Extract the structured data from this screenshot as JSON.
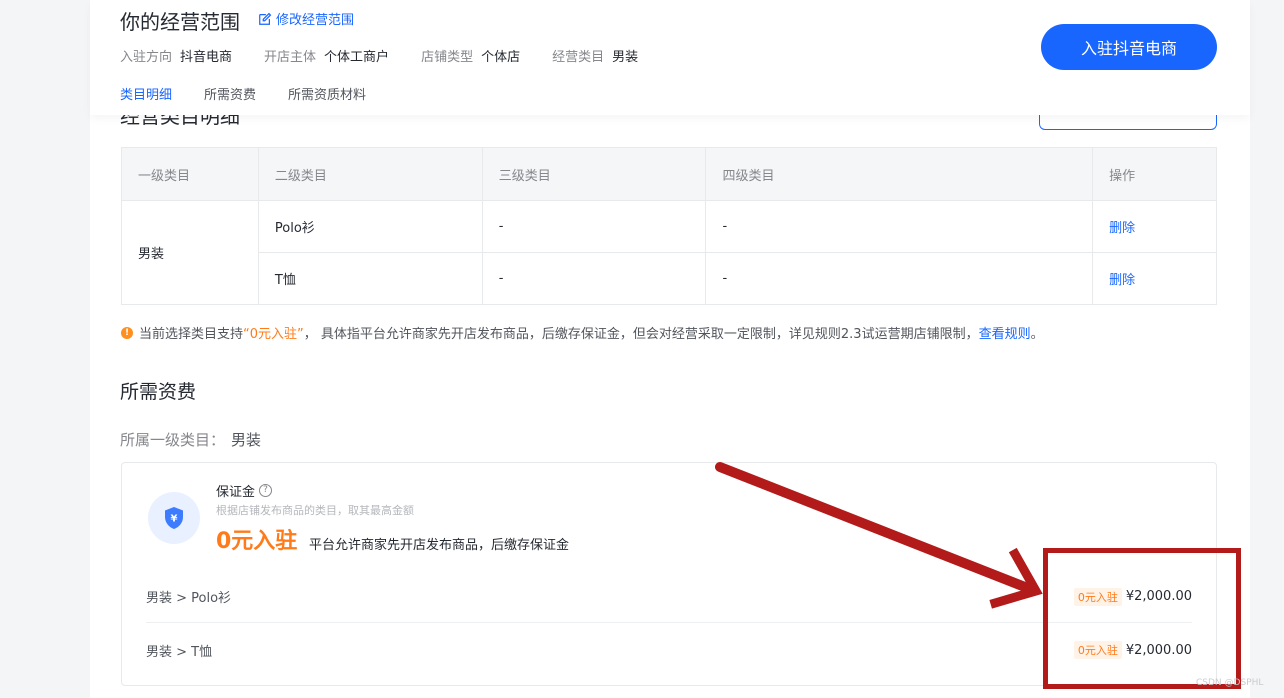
{
  "header": {
    "title": "你的经营范围",
    "edit_label": "修改经营范围",
    "join_button": "入驻抖音电商",
    "info": [
      {
        "label": "入驻方向",
        "value": "抖音电商"
      },
      {
        "label": "开店主体",
        "value": "个体工商户"
      },
      {
        "label": "店铺类型",
        "value": "个体店"
      },
      {
        "label": "经营类目",
        "value": "男装"
      }
    ],
    "tabs": [
      "类目明细",
      "所需资费",
      "所需资质材料"
    ]
  },
  "category_section": {
    "title": "经营类目明细"
  },
  "table": {
    "headers": [
      "一级类目",
      "二级类目",
      "三级类目",
      "四级类目",
      "操作"
    ],
    "group": "男装",
    "rows": [
      {
        "level2": "Polo衫",
        "level3": "-",
        "level4": "-",
        "action": "删除"
      },
      {
        "level2": "T恤",
        "level3": "-",
        "level4": "-",
        "action": "删除"
      }
    ]
  },
  "notice": {
    "prefix": "当前选择类目支持",
    "highlight": "“0元入驻”",
    "middle": "， 具体指平台允许商家先开店发布商品，后缴存保证金，但会对经营采取一定限制，详见规则2.3试运营期店铺限制，",
    "link": "查看规则",
    "suffix": "。"
  },
  "fees": {
    "title": "所需资费",
    "category_label": "所属一级类目：",
    "category_value": "男装",
    "deposit_label": "保证金",
    "deposit_desc": "根据店铺发布商品的类目，取其最高金额",
    "zero_entry": "0元入驻",
    "zero_note": "平台允许商家先开店发布商品，后缴存保证金",
    "items": [
      {
        "path": "男装 > Polo衫",
        "badge": "0元入驻",
        "price": "¥2,000.00"
      },
      {
        "path": "男装 > T恤",
        "badge": "0元入驻",
        "price": "¥2,000.00"
      }
    ]
  },
  "watermark": "CSDN @DSPHL",
  "colors": {
    "accent": "#1966ff",
    "orange": "#ff7b1a",
    "annotation": "#b31b1b"
  }
}
